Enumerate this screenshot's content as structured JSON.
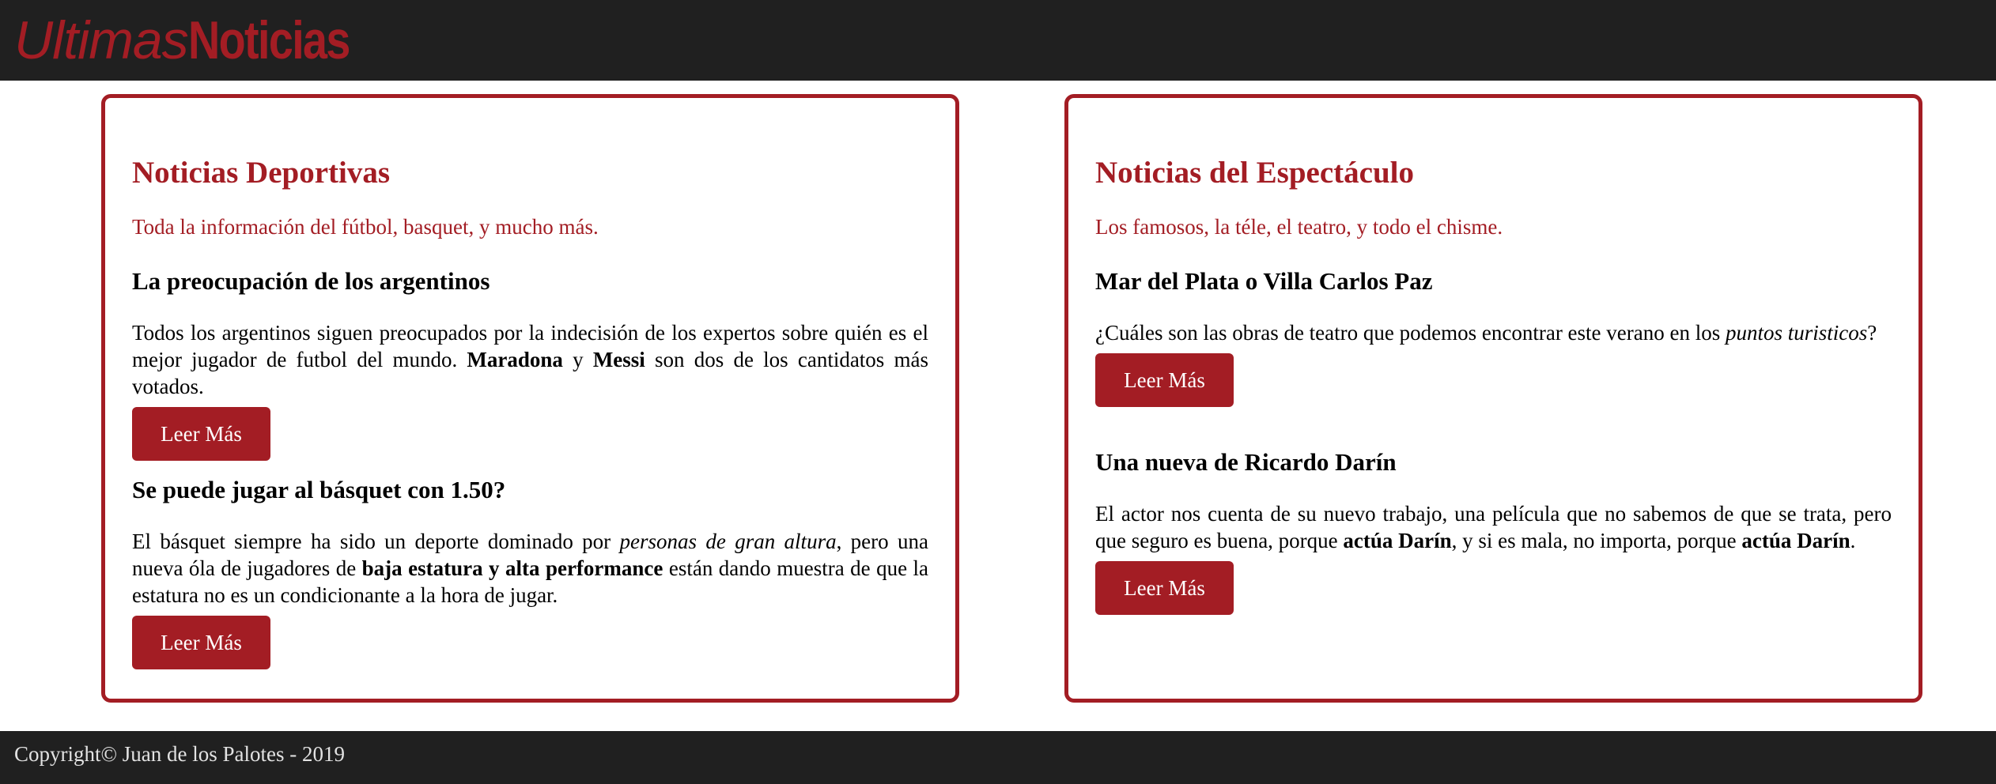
{
  "header": {
    "logo_part1": "Ultimas",
    "logo_part2": "Noticias"
  },
  "sections": [
    {
      "title": "Noticias Deportivas",
      "subtitle": "Toda la información del fútbol, basquet, y mucho más.",
      "articles": [
        {
          "title": "La preocupación de los argentinos",
          "body_segments": [
            {
              "text": "Todos los argentinos siguen preocupados por la indecisión de los expertos sobre quién es el mejor jugador de futbol del mundo. ",
              "style": "normal"
            },
            {
              "text": "Maradona",
              "style": "bold"
            },
            {
              "text": " y ",
              "style": "normal"
            },
            {
              "text": "Messi",
              "style": "bold"
            },
            {
              "text": " son dos de los cantidatos más votados.",
              "style": "normal"
            }
          ],
          "button_label": "Leer Más"
        },
        {
          "title": "Se puede jugar al básquet con 1.50?",
          "body_segments": [
            {
              "text": "El básquet siempre ha sido un deporte dominado por ",
              "style": "normal"
            },
            {
              "text": "personas de gran altura",
              "style": "italic"
            },
            {
              "text": ", pero una nueva óla de jugadores de ",
              "style": "normal"
            },
            {
              "text": "baja estatura y alta performance",
              "style": "bold"
            },
            {
              "text": " están dando muestra de que la estatura no es un condicionante a la hora de jugar.",
              "style": "normal"
            }
          ],
          "button_label": "Leer Más"
        }
      ]
    },
    {
      "title": "Noticias del Espectáculo",
      "subtitle": "Los famosos, la téle, el teatro, y todo el chisme.",
      "articles": [
        {
          "title": "Mar del Plata o Villa Carlos Paz",
          "body_segments": [
            {
              "text": "¿Cuáles son las obras de teatro que podemos encontrar este verano en los ",
              "style": "normal"
            },
            {
              "text": "puntos turisticos",
              "style": "italic"
            },
            {
              "text": "?",
              "style": "normal"
            }
          ],
          "button_label": "Leer Más"
        },
        {
          "title": "Una nueva de Ricardo Darín",
          "body_segments": [
            {
              "text": "El actor nos cuenta de su nuevo trabajo, una película que no sabemos de que se trata, pero que seguro es buena, porque ",
              "style": "normal"
            },
            {
              "text": "actúa Darín",
              "style": "bold"
            },
            {
              "text": ", y si es mala, no importa, porque ",
              "style": "normal"
            },
            {
              "text": "actúa Darín",
              "style": "bold"
            },
            {
              "text": ".",
              "style": "normal"
            }
          ],
          "button_label": "Leer Más"
        }
      ]
    }
  ],
  "footer": {
    "copyright": "Copyright© Juan de los Palotes - 2019"
  },
  "colors": {
    "accent": "#a31d24",
    "bar_background": "#202020",
    "footer_text": "#e2e2e2"
  }
}
